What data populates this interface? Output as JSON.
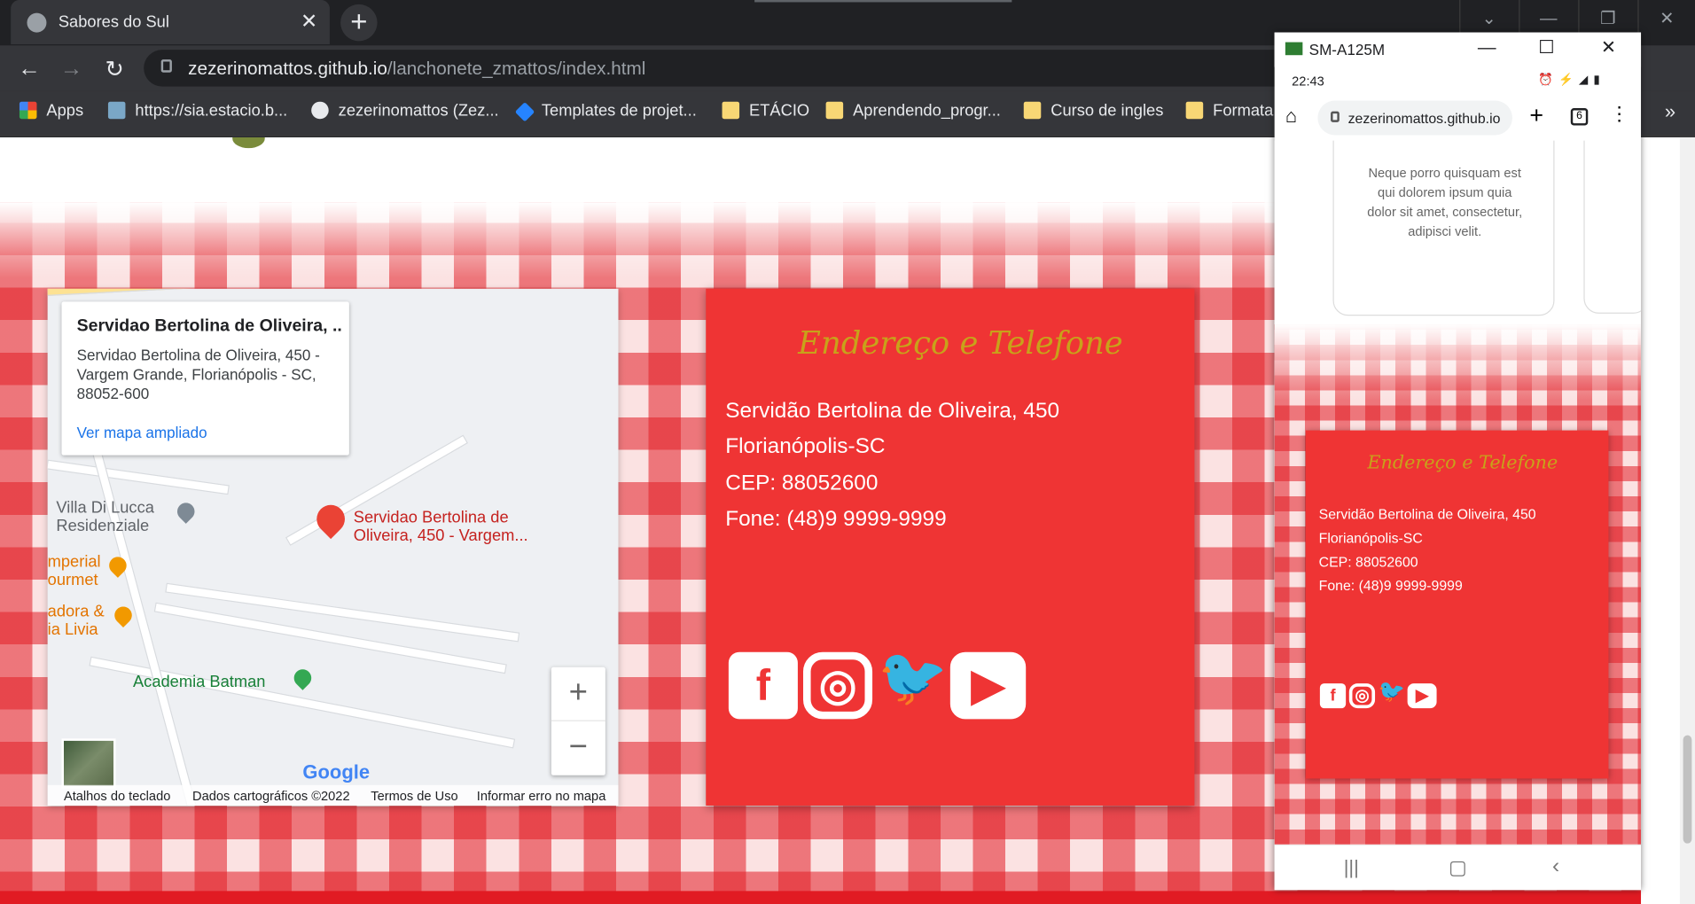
{
  "browser": {
    "tab_title": "Sabores do Sul",
    "url_host": "zezerinomattos.github.io",
    "url_path": "/lanchonete_zmattos/index.html"
  },
  "bookmarks": [
    {
      "label": "Apps",
      "icon": "apps-grid-icon"
    },
    {
      "label": "https://sia.estacio.b...",
      "icon": "site-icon"
    },
    {
      "label": "zezerinomattos (Zez...",
      "icon": "github-icon"
    },
    {
      "label": "Templates de projet...",
      "icon": "jira-icon"
    },
    {
      "label": "ETÁCIO",
      "icon": "folder-icon"
    },
    {
      "label": "Aprendendo_progr...",
      "icon": "folder-icon"
    },
    {
      "label": "Curso de ingles",
      "icon": "folder-icon"
    },
    {
      "label": "Formata",
      "icon": "folder-icon"
    }
  ],
  "map": {
    "place_title": "Servidao Bertolina de Oliveira, ...",
    "place_address": "Servidao Bertolina de Oliveira, 450 - Vargem Grande, Florianópolis - SC, 88052-600",
    "view_larger": "Ver mapa ampliado",
    "marker_label": "Servidao Bertolina de Oliveira, 450 - Vargem...",
    "poi_villa": "Villa Di Lucca Residenziale",
    "poi_imperial": "mperial ourmet",
    "poi_livia": "adora & ia Livia",
    "poi_academia": "Academia Batman",
    "zoom_in": "+",
    "zoom_out": "−",
    "google": "Google",
    "footer": {
      "shortcuts": "Atalhos do teclado",
      "data": "Dados cartográficos ©2022",
      "terms": "Termos de Uso",
      "report": "Informar erro no mapa"
    }
  },
  "contact": {
    "heading": "Endereço e Telefone",
    "street": "Servidão Bertolina de Oliveira, 450",
    "city": "Florianópolis-SC",
    "cep": "CEP: 88052600",
    "phone": "Fone: (48)9 9999-9999"
  },
  "phone_window": {
    "device": "SM-A125M",
    "time": "22:43",
    "url": "zezerinomattos.github.io",
    "tabs_count": "6",
    "card_text": "Neque porro quisquam est qui dolorem ipsum quia dolor sit amet, consectetur, adipisci velit."
  },
  "colors": {
    "accent_red": "#ef3434",
    "heading_gold": "#c8a21a",
    "link_blue": "#1a73e8"
  }
}
